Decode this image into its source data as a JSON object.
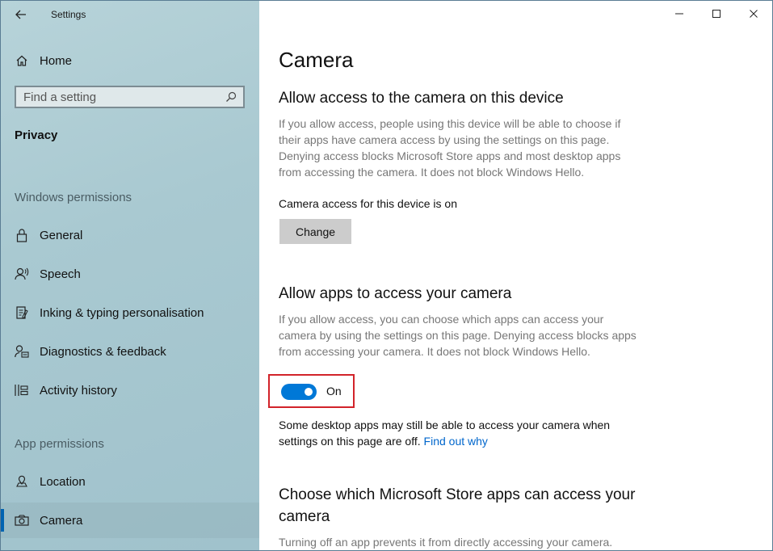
{
  "window": {
    "title": "Settings"
  },
  "sidebar": {
    "home_label": "Home",
    "search_placeholder": "Find a setting",
    "section_title": "Privacy",
    "groups": [
      {
        "heading": "Windows permissions",
        "items": [
          {
            "label": "General",
            "icon": "lock-icon"
          },
          {
            "label": "Speech",
            "icon": "speech-icon"
          },
          {
            "label": "Inking & typing personalisation",
            "icon": "inking-icon"
          },
          {
            "label": "Diagnostics & feedback",
            "icon": "diagnostics-icon"
          },
          {
            "label": "Activity history",
            "icon": "activity-icon"
          }
        ]
      },
      {
        "heading": "App permissions",
        "items": [
          {
            "label": "Location",
            "icon": "location-icon"
          },
          {
            "label": "Camera",
            "icon": "camera-icon",
            "selected": true
          }
        ]
      }
    ]
  },
  "main": {
    "title": "Camera",
    "device_section": {
      "heading": "Allow access to the camera on this device",
      "description": "If you allow access, people using this device will be able to choose if their apps have camera access by using the settings on this page. Denying access blocks Microsoft Store apps and most desktop apps from accessing the camera. It does not block Windows Hello.",
      "status": "Camera access for this device is on",
      "change_label": "Change"
    },
    "apps_section": {
      "heading": "Allow apps to access your camera",
      "description": "If you allow access, you can choose which apps can access your camera by using the settings on this page. Denying access blocks apps from accessing your camera. It does not block Windows Hello.",
      "toggle_state": "On",
      "note": "Some desktop apps may still be able to access your camera when settings on this page are off.",
      "note_link": "Find out why"
    },
    "store_section": {
      "heading": "Choose which Microsoft Store apps can access your camera",
      "description": "Turning off an app prevents it from directly accessing your camera."
    }
  },
  "colors": {
    "accent": "#0078d7",
    "highlight_box": "#d2232a",
    "link": "#0066cc"
  }
}
